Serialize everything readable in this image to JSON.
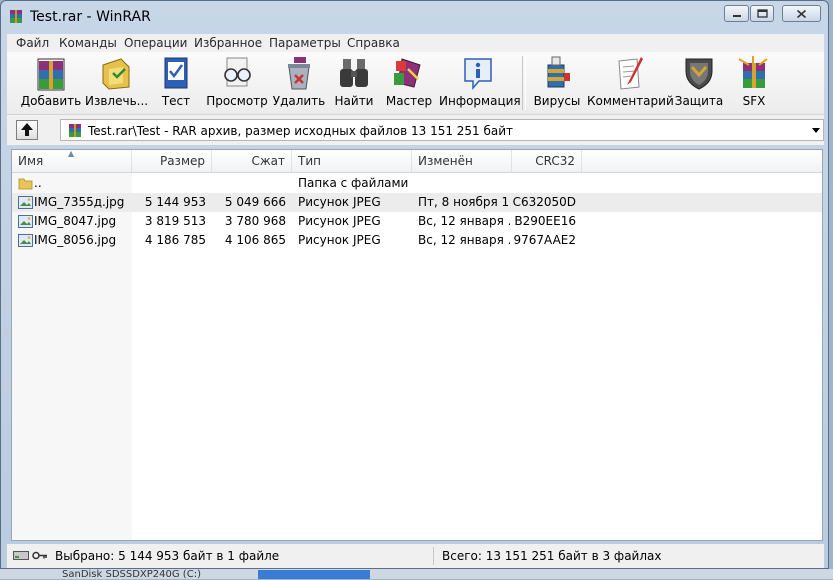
{
  "window": {
    "title": "Test.rar - WinRAR"
  },
  "background": {
    "taskbar_text": "SanDisk SDSSDXP240G (C:)"
  },
  "menu": [
    "Файл",
    "Команды",
    "Операции",
    "Избранное",
    "Параметры",
    "Справка"
  ],
  "toolbar": {
    "add": "Добавить",
    "extract": "Извлечь...",
    "test": "Тест",
    "view": "Просмотр",
    "delete": "Удалить",
    "find": "Найти",
    "wizard": "Мастер",
    "info": "Информация",
    "virus": "Вирусы",
    "comment": "Комментарий",
    "protect": "Защита",
    "sfx": "SFX"
  },
  "address": {
    "path": "Test.rar\\Test - RAR архив, размер исходных файлов 13 151 251 байт"
  },
  "columns": {
    "name": "Имя",
    "size": "Размер",
    "packed": "Сжат",
    "type": "Тип",
    "modified": "Изменён",
    "crc": "CRC32"
  },
  "files": [
    {
      "name": "..",
      "size": "",
      "packed": "",
      "type": "Папка с файлами",
      "modified": "",
      "crc": "",
      "icon": "folder-icon"
    },
    {
      "name": "IMG_7355д.jpg",
      "size": "5 144 953",
      "packed": "5 049 666",
      "type": "Рисунок JPEG",
      "modified": "Пт, 8 ноября 1...",
      "crc": "C632050D",
      "icon": "image-file-icon"
    },
    {
      "name": "IMG_8047.jpg",
      "size": "3 819 513",
      "packed": "3 780 968",
      "type": "Рисунок JPEG",
      "modified": "Вс, 12 января ...",
      "crc": "B290EE16",
      "icon": "image-file-icon"
    },
    {
      "name": "IMG_8056.jpg",
      "size": "4 186 785",
      "packed": "4 106 865",
      "type": "Рисунок JPEG",
      "modified": "Вс, 12 января ...",
      "crc": "9767AAE2",
      "icon": "image-file-icon"
    }
  ],
  "status": {
    "selected": "Выбрано: 5 144 953 байт в 1 файле",
    "total": "Всего: 13 151 251 байт в 3 файлах"
  }
}
